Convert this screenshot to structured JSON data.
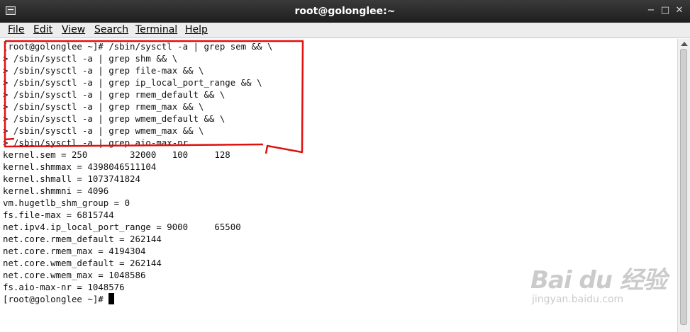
{
  "window": {
    "title": "root@golonglee:~",
    "controls": {
      "minimize": "−",
      "maximize": "□",
      "close": "✕"
    }
  },
  "menu": [
    "File",
    "Edit",
    "View",
    "Search",
    "Terminal",
    "Help"
  ],
  "terminal": {
    "lines": [
      "[root@golonglee ~]# /sbin/sysctl -a | grep sem && \\",
      "> /sbin/sysctl -a | grep shm && \\",
      "> /sbin/sysctl -a | grep file-max && \\",
      "> /sbin/sysctl -a | grep ip_local_port_range && \\",
      "> /sbin/sysctl -a | grep rmem_default && \\",
      "> /sbin/sysctl -a | grep rmem_max && \\",
      "> /sbin/sysctl -a | grep wmem_default && \\",
      "> /sbin/sysctl -a | grep wmem_max && \\",
      "> /sbin/sysctl -a | grep aio-max-nr",
      "kernel.sem = 250        32000   100     128",
      "kernel.shmmax = 4398046511104",
      "kernel.shmall = 1073741824",
      "kernel.shmmni = 4096",
      "vm.hugetlb_shm_group = 0",
      "fs.file-max = 6815744",
      "net.ipv4.ip_local_port_range = 9000     65500",
      "net.core.rmem_default = 262144",
      "net.core.rmem_max = 4194304",
      "net.core.wmem_default = 262144",
      "net.core.wmem_max = 1048586",
      "fs.aio-max-nr = 1048576"
    ],
    "prompt": "[root@golonglee ~]# "
  },
  "watermark": {
    "logo": "Bai du 经验",
    "url": "jingyan.baidu.com"
  },
  "colors": {
    "annotation": "#e01010",
    "titlebar": "#2a2a2a",
    "menubar": "#ededed"
  }
}
